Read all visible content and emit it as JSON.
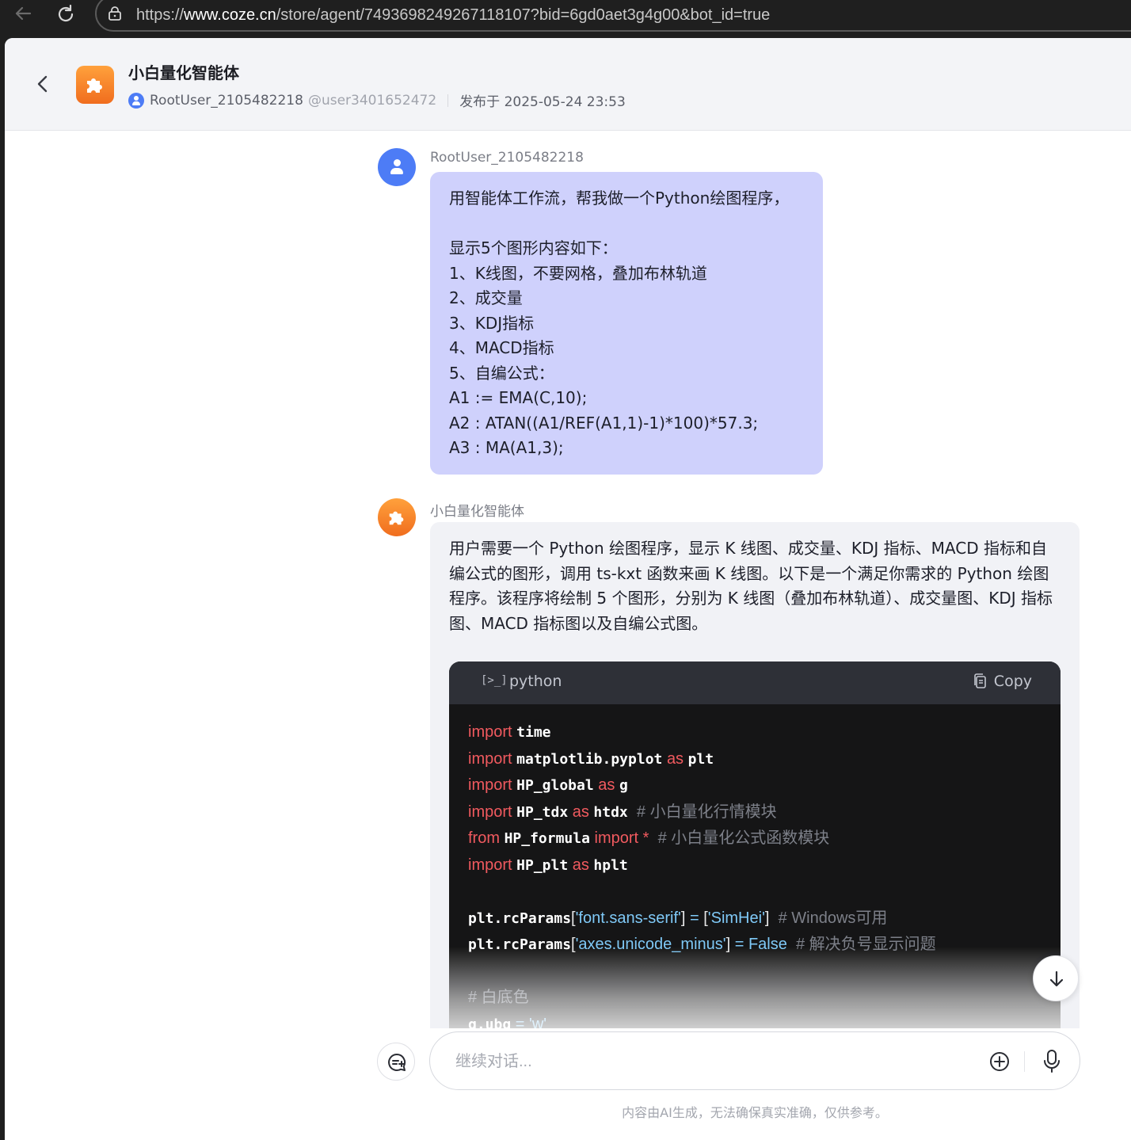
{
  "browser": {
    "url_prefix": "https://",
    "url_domain": "www.coze.cn",
    "url_path": "/store/agent/7493698249267118107?bid=6gd0aet3g4g00&bot_id=true"
  },
  "header": {
    "title": "小白量化智能体",
    "author": "RootUser_2105482218",
    "handle": "@user3401652472",
    "published": "发布于 2025-05-24 23:53"
  },
  "user_message": {
    "sender": "RootUser_2105482218",
    "lines": [
      "用智能体工作流，帮我做一个Python绘图程序，",
      "",
      "显示5个图形内容如下：",
      "1、K线图，不要网格，叠加布林轨道",
      "2、成交量",
      "3、KDJ指标",
      "4、MACD指标",
      "5、自编公式：",
      "A1 := EMA(C,10);",
      "A2 : ATAN((A1/REF(A1,1)-1)*100)*57.3;",
      "A3 : MA(A1,3);"
    ]
  },
  "bot_message": {
    "sender": "小白量化智能体",
    "text": "用户需要一个 Python 绘图程序，显示 K 线图、成交量、KDJ 指标、MACD 指标和自编公式的图形，调用 ts-kxt 函数来画 K 线图。以下是一个满足你需求的 Python 绘图程序。该程序将绘制 5 个图形，分别为 K 线图（叠加布林轨道）、成交量图、KDJ 指标图、MACD 指标图以及自编公式图。",
    "code": {
      "language": "python",
      "lang_icon": "[>_]",
      "copy_label": "Copy",
      "lines": [
        [
          [
            "kw",
            "import"
          ],
          [
            "sp",
            " "
          ],
          [
            "id",
            "time"
          ]
        ],
        [
          [
            "kw",
            "import"
          ],
          [
            "sp",
            " "
          ],
          [
            "id",
            "matplotlib.pyplot"
          ],
          [
            "sp",
            " "
          ],
          [
            "kw",
            "as"
          ],
          [
            "sp",
            " "
          ],
          [
            "id",
            "plt"
          ]
        ],
        [
          [
            "kw",
            "import"
          ],
          [
            "sp",
            " "
          ],
          [
            "id",
            "HP_global"
          ],
          [
            "sp",
            " "
          ],
          [
            "kw",
            "as"
          ],
          [
            "sp",
            " "
          ],
          [
            "id",
            "g"
          ]
        ],
        [
          [
            "kw",
            "import"
          ],
          [
            "sp",
            " "
          ],
          [
            "id",
            "HP_tdx"
          ],
          [
            "sp",
            " "
          ],
          [
            "kw",
            "as"
          ],
          [
            "sp",
            " "
          ],
          [
            "id",
            "htdx"
          ],
          [
            "sp",
            "  "
          ],
          [
            "cm",
            "# 小白量化行情模块"
          ]
        ],
        [
          [
            "kw",
            "from"
          ],
          [
            "sp",
            " "
          ],
          [
            "id",
            "HP_formula"
          ],
          [
            "sp",
            " "
          ],
          [
            "kw",
            "import"
          ],
          [
            "sp",
            " "
          ],
          [
            "kw",
            "*"
          ],
          [
            "sp",
            "  "
          ],
          [
            "cm",
            "# 小白量化公式函数模块"
          ]
        ],
        [
          [
            "kw",
            "import"
          ],
          [
            "sp",
            " "
          ],
          [
            "id",
            "HP_plt"
          ],
          [
            "sp",
            " "
          ],
          [
            "kw",
            "as"
          ],
          [
            "sp",
            " "
          ],
          [
            "id",
            "hplt"
          ]
        ],
        [],
        [
          [
            "id",
            "plt.rcParams"
          ],
          [
            "pun",
            "["
          ],
          [
            "str",
            "'font.sans-serif'"
          ],
          [
            "pun",
            "]"
          ],
          [
            "sp",
            " "
          ],
          [
            "op",
            "="
          ],
          [
            "sp",
            " "
          ],
          [
            "pun",
            "["
          ],
          [
            "str",
            "'SimHei'"
          ],
          [
            "pun",
            "]"
          ],
          [
            "sp",
            "  "
          ],
          [
            "cm",
            "# Windows可用"
          ]
        ],
        [
          [
            "id",
            "plt.rcParams"
          ],
          [
            "pun",
            "["
          ],
          [
            "str",
            "'axes.unicode_minus'"
          ],
          [
            "pun",
            "]"
          ],
          [
            "sp",
            " "
          ],
          [
            "op",
            "="
          ],
          [
            "sp",
            " "
          ],
          [
            "str",
            "False"
          ],
          [
            "sp",
            "  "
          ],
          [
            "cm",
            "# 解决负号显示问题"
          ]
        ],
        [],
        [
          [
            "cm",
            "# 白底色"
          ]
        ],
        [
          [
            "id",
            "g.ubg"
          ],
          [
            "sp",
            " "
          ],
          [
            "op",
            "="
          ],
          [
            "sp",
            " "
          ],
          [
            "str",
            "'w'"
          ]
        ]
      ]
    }
  },
  "composer": {
    "placeholder": "继续对话...",
    "disclaimer": "内容由AI生成，无法确保真实准确，仅供参考。"
  },
  "colors": {
    "user_bubble": "#cfd1fc",
    "bot_bubble": "#f1f2f6",
    "accent": "#4d7cf6",
    "bot_logo": "#f3822a",
    "code_keyword": "#f15a5f",
    "code_string": "#7fc9f7"
  }
}
